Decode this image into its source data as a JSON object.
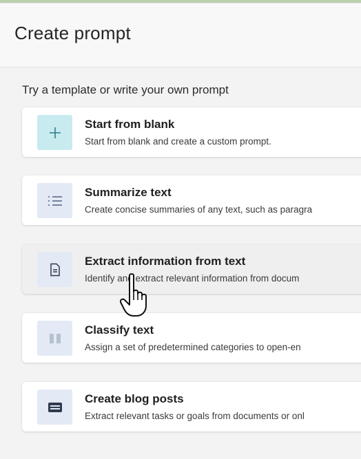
{
  "header": {
    "title": "Create prompt"
  },
  "subtitle": "Try a template or write your own prompt",
  "templates": [
    {
      "title": "Start from blank",
      "description": "Start from blank and create a custom prompt.",
      "icon": "plus-icon"
    },
    {
      "title": "Summarize text",
      "description": "Create concise summaries of any text, such as paragra",
      "icon": "list-icon"
    },
    {
      "title": "Extract information from text",
      "description": "Identify and extract relevant information from docum",
      "icon": "document-icon",
      "state": "hovered"
    },
    {
      "title": "Classify text",
      "description": "Assign a set of predetermined categories to open-en",
      "icon": "columns-icon"
    },
    {
      "title": "Create blog posts",
      "description": "Extract relevant tasks or goals from documents or onl",
      "icon": "keyboard-icon"
    }
  ],
  "colors": {
    "accent_blank_icon_bg": "#c7ebef",
    "icon_bg": "#e3e9f5",
    "icon_fg": "#50627e",
    "plus_fg": "#2f7e8c"
  }
}
